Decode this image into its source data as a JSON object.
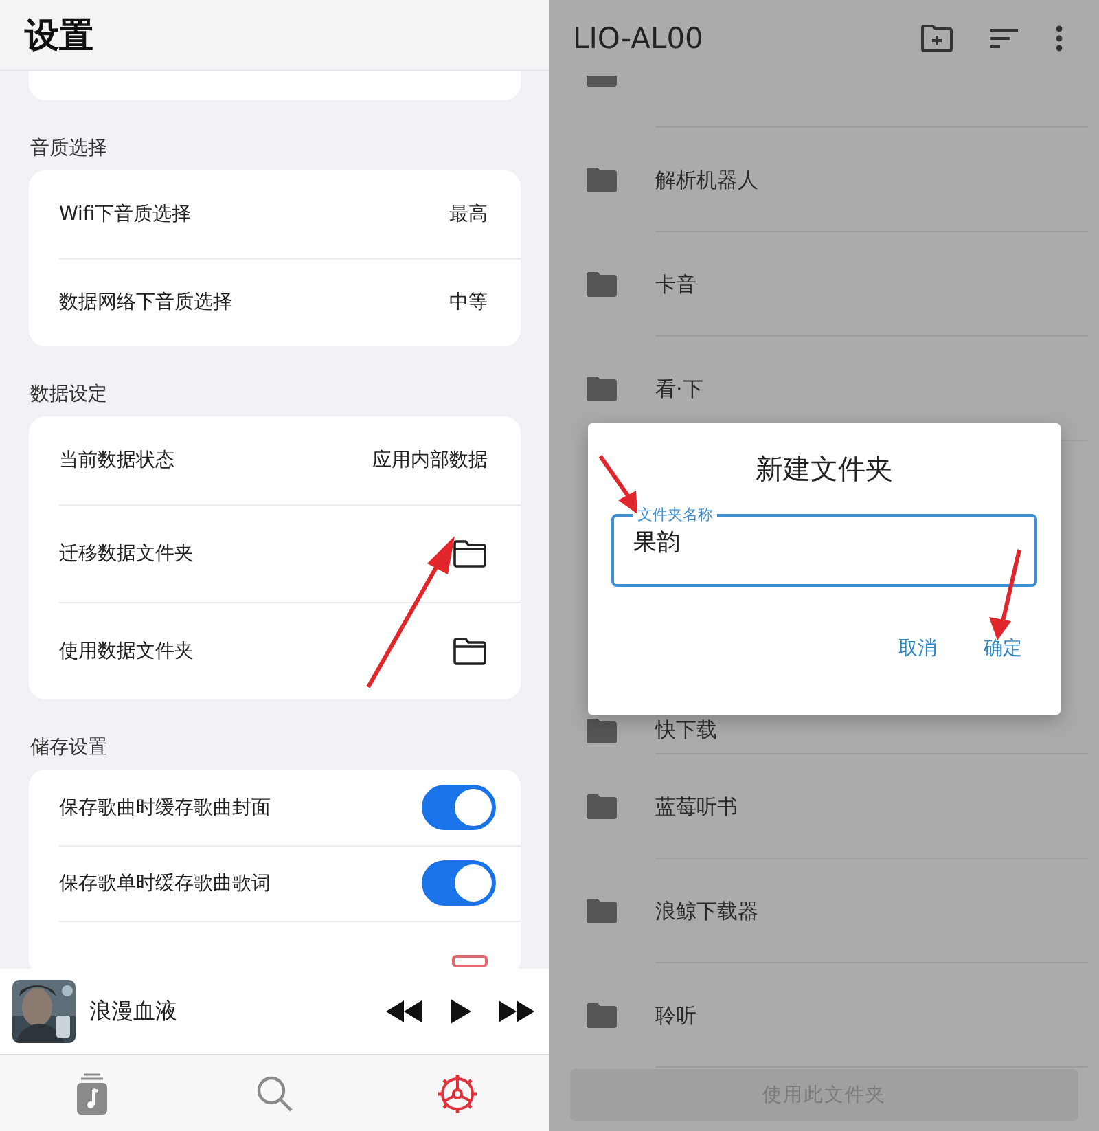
{
  "settings": {
    "title": "设置",
    "sections": [
      {
        "heading": "音质选择",
        "rows": [
          {
            "kind": "value",
            "label": "Wifi下音质选择",
            "value": "最高"
          },
          {
            "kind": "value",
            "label": "数据网络下音质选择",
            "value": "中等"
          }
        ]
      },
      {
        "heading": "数据设定",
        "rows": [
          {
            "kind": "value",
            "label": "当前数据状态",
            "value": "应用内部数据"
          },
          {
            "kind": "folder",
            "label": "迁移数据文件夹"
          },
          {
            "kind": "folder",
            "label": "使用数据文件夹"
          }
        ]
      },
      {
        "heading": "储存设置",
        "rows": [
          {
            "kind": "toggle",
            "label": "保存歌曲时缓存歌曲封面",
            "on": true
          },
          {
            "kind": "toggle",
            "label": "保存歌单时缓存歌曲歌词",
            "on": true
          }
        ]
      }
    ]
  },
  "player": {
    "song": "浪漫血液"
  },
  "tabs": [
    {
      "kind": "library",
      "selected": false
    },
    {
      "kind": "search",
      "selected": false
    },
    {
      "kind": "settings",
      "selected": true
    }
  ],
  "folder_picker": {
    "title": "LIO-AL00",
    "folders_above": [
      "解析机器人",
      "卡音",
      "看·下"
    ],
    "folders_below": [
      "快下载",
      "蓝莓听书",
      "浪鲸下载器",
      "聆听"
    ],
    "use_button": "使用此文件夹"
  },
  "dialog": {
    "title": "新建文件夹",
    "field": {
      "label": "文件夹名称",
      "value": "果韵"
    },
    "buttons": [
      "取消",
      "确定"
    ]
  }
}
